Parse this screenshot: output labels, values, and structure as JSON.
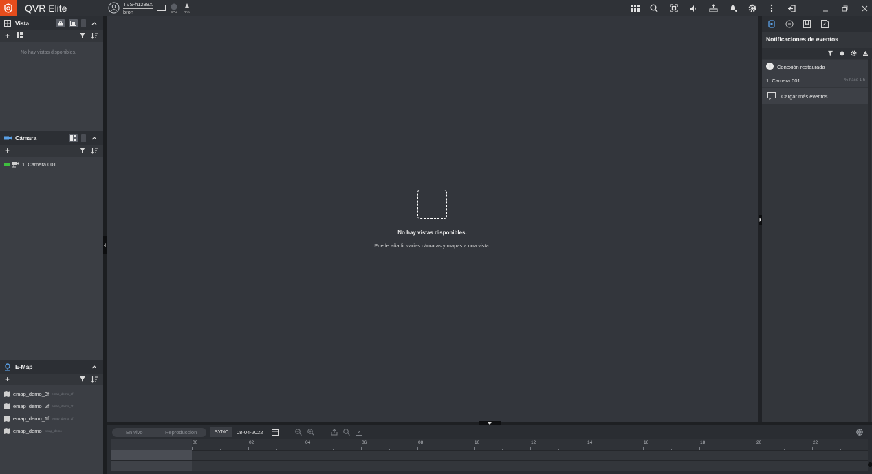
{
  "app": {
    "title": "QVR Elite"
  },
  "nas": {
    "name": "TVS-h1288X",
    "user": "bron"
  },
  "monitors": {
    "cpu_label": "CPU",
    "ram_label": "RAM"
  },
  "left": {
    "vista": {
      "title": "Vista",
      "empty": "No hay vistas disponibles."
    },
    "camara": {
      "title": "Cámara",
      "items": [
        {
          "label": "1. Camera 001"
        }
      ]
    },
    "emap": {
      "title": "E-Map",
      "items": [
        {
          "label": "emap_demo_3f",
          "sub": "emap_demo_3f"
        },
        {
          "label": "emap_demo_2f",
          "sub": "emap_demo_2f"
        },
        {
          "label": "emap_demo_1f",
          "sub": "emap_demo_1f"
        },
        {
          "label": "emap_demo",
          "sub": "emap_demo"
        }
      ]
    }
  },
  "main": {
    "msg1": "No hay vistas disponibles.",
    "msg2": "Puede añadir varias cámaras y mapas a una vista."
  },
  "right": {
    "title": "Notificaciones de eventos",
    "notification": {
      "message": "Conexión restaurada",
      "camera": "1. Camera 001",
      "time": "hace 1 h"
    },
    "load_more": "Cargar más eventos"
  },
  "bottom": {
    "mode_live": "En vivo",
    "mode_playback": "Reproducción",
    "sync": "SYNC",
    "date": "08-04-2022",
    "hours": [
      "00",
      "02",
      "04",
      "06",
      "08",
      "10",
      "12",
      "14",
      "16",
      "18",
      "20",
      "22"
    ]
  },
  "colors": {
    "brand": "#e64d1c",
    "camera_online": "#3fbf3f"
  }
}
